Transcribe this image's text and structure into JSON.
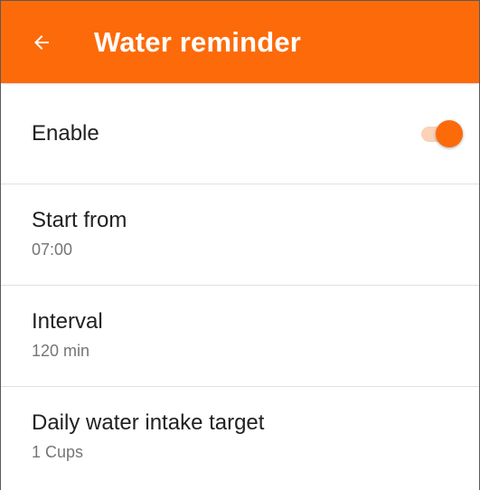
{
  "header": {
    "title": "Water reminder",
    "back_icon": "arrow-left-icon",
    "color": "#fd6a09"
  },
  "settings": {
    "enable": {
      "label": "Enable",
      "value": true
    },
    "start_from": {
      "label": "Start from",
      "value": "07:00"
    },
    "interval": {
      "label": "Interval",
      "value": "120 min"
    },
    "daily_target": {
      "label": "Daily water intake target",
      "value": "1 Cups"
    }
  }
}
